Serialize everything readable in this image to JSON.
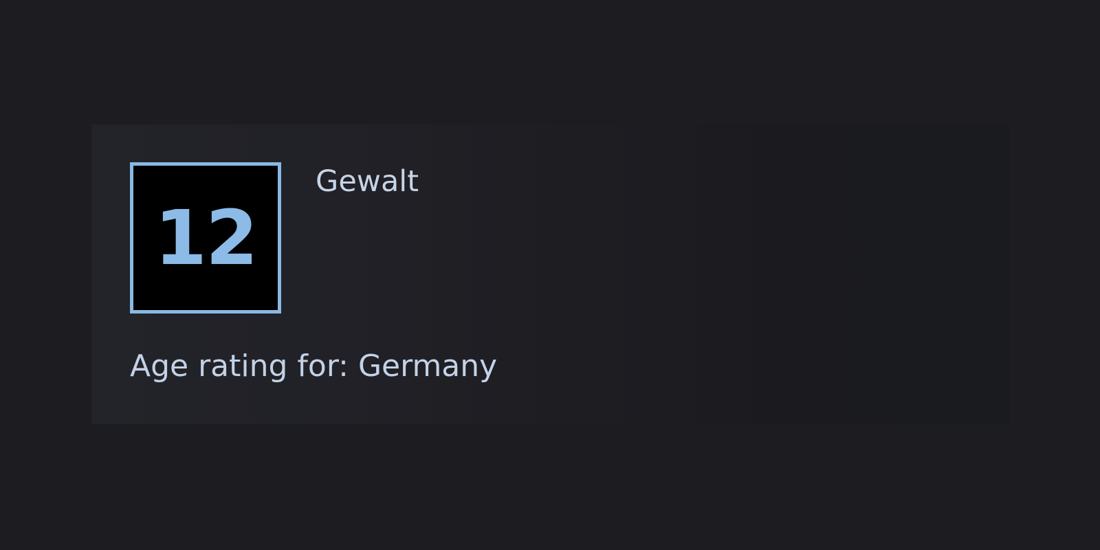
{
  "age_rating": {
    "badge_value": "12",
    "descriptor": "Gewalt",
    "region_label": "Age rating for: Germany"
  },
  "colors": {
    "page_background": "#1c1c21",
    "panel_background_left": "#222429",
    "panel_background_right": "#1a1b1e",
    "badge_border": "#89b9e4",
    "badge_background": "#000000",
    "badge_text": "#8cbbe8",
    "text": "#c6d4e6"
  }
}
